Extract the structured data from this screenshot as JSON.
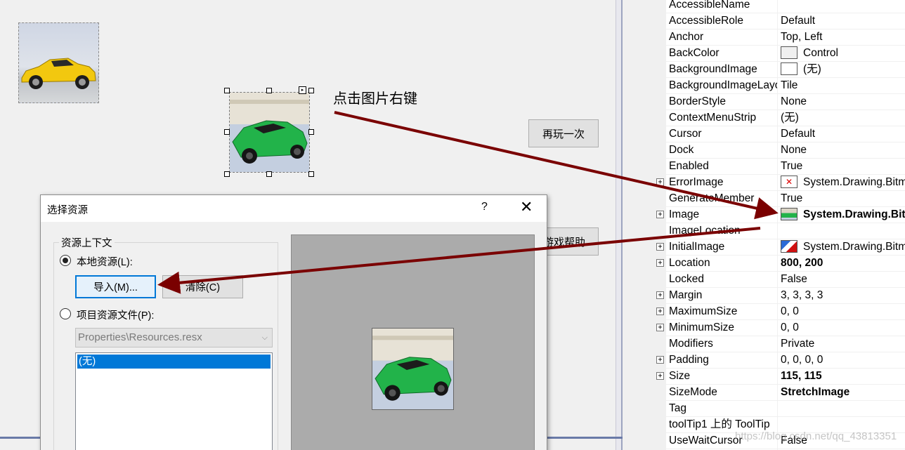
{
  "designer": {
    "note": "点击图片右键",
    "replay_button": "再玩一次",
    "help_button": "游戏帮助"
  },
  "dialog": {
    "title": "选择资源",
    "help_icon": "?",
    "group_label": "资源上下文",
    "local_resource": "本地资源(L):",
    "import_button": "导入(M)...",
    "clear_button": "清除(C)",
    "project_resource": "项目资源文件(P):",
    "resx_select": "Properties\\Resources.resx",
    "list_selected": "(无)"
  },
  "properties": [
    {
      "name": "AccessibleName",
      "value": "",
      "expand": false
    },
    {
      "name": "AccessibleRole",
      "value": "Default",
      "expand": false
    },
    {
      "name": "Anchor",
      "value": "Top, Left",
      "expand": false
    },
    {
      "name": "BackColor",
      "value": "Control",
      "expand": false,
      "swatch": "#f0f0f0"
    },
    {
      "name": "BackgroundImage",
      "value": "(无)",
      "expand": false,
      "swatch": "#ffffff"
    },
    {
      "name": "BackgroundImageLayout",
      "value": "Tile",
      "expand": false
    },
    {
      "name": "BorderStyle",
      "value": "None",
      "expand": false
    },
    {
      "name": "ContextMenuStrip",
      "value": "(无)",
      "expand": false
    },
    {
      "name": "Cursor",
      "value": "Default",
      "expand": false
    },
    {
      "name": "Dock",
      "value": "None",
      "expand": false
    },
    {
      "name": "Enabled",
      "value": "True",
      "expand": false
    },
    {
      "name": "ErrorImage",
      "value": "System.Drawing.Bitmap",
      "expand": true,
      "icon": "error-image"
    },
    {
      "name": "GenerateMember",
      "value": "True",
      "expand": false
    },
    {
      "name": "Image",
      "value": "System.Drawing.Bitmap",
      "expand": true,
      "bold": true,
      "icon": "car-thumb"
    },
    {
      "name": "ImageLocation",
      "value": "",
      "expand": false
    },
    {
      "name": "InitialImage",
      "value": "System.Drawing.Bitmap",
      "expand": true,
      "icon": "initial-image"
    },
    {
      "name": "Location",
      "value": "800, 200",
      "expand": true,
      "bold": true
    },
    {
      "name": "Locked",
      "value": "False",
      "expand": false
    },
    {
      "name": "Margin",
      "value": "3, 3, 3, 3",
      "expand": true
    },
    {
      "name": "MaximumSize",
      "value": "0, 0",
      "expand": true
    },
    {
      "name": "MinimumSize",
      "value": "0, 0",
      "expand": true
    },
    {
      "name": "Modifiers",
      "value": "Private",
      "expand": false
    },
    {
      "name": "Padding",
      "value": "0, 0, 0, 0",
      "expand": true
    },
    {
      "name": "Size",
      "value": "115, 115",
      "expand": true,
      "bold": true
    },
    {
      "name": "SizeMode",
      "value": "StretchImage",
      "expand": false,
      "bold": true
    },
    {
      "name": "Tag",
      "value": "",
      "expand": false
    },
    {
      "name": "toolTip1 上的 ToolTip",
      "value": "",
      "expand": false
    },
    {
      "name": "UseWaitCursor",
      "value": "False",
      "expand": false
    }
  ],
  "watermark": "https://blog.csdn.net/qq_43813351",
  "colors": {
    "arrow": "#7a0000",
    "selection": "#0078d7",
    "preview_bg": "#ababab"
  }
}
